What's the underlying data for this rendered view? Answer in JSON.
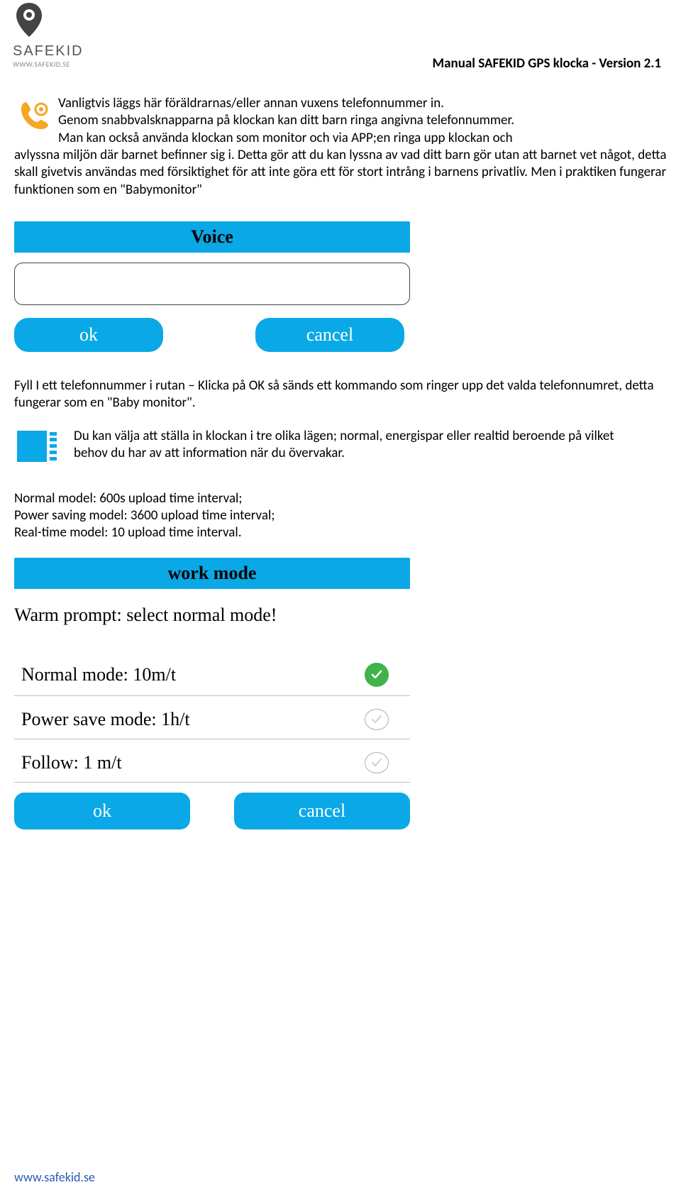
{
  "header": {
    "logo_text": "SAFEKID",
    "logo_url": "WWW.SAFEKID.SE",
    "title": "Manual SAFEKID GPS klocka - Version 2.1"
  },
  "section1": {
    "line1": "Vanligtvis läggs här föräldrarnas/eller annan vuxens telefonnummer in.",
    "line2": "Genom snabbvalsknapparna på klockan kan ditt barn ringa angivna telefonnummer.",
    "line3": "Man kan också använda klockan som monitor och via APP;en ringa upp klockan och",
    "cont": "avlyssna miljön där barnet befinner sig i. Detta gör att du kan lyssna av vad ditt barn gör utan att barnet vet något, detta skall givetvis användas med försiktighet för att inte göra ett för stort intrång i barnens privatliv. Men i praktiken fungerar funktionen som en \"Babymonitor\""
  },
  "voice_panel": {
    "title": "Voice",
    "ok": "ok",
    "cancel": "cancel"
  },
  "section2": {
    "text": "Fyll I ett telefonnummer i rutan – Klicka på OK så sänds ett kommando som ringer upp det valda telefonnumret, detta fungerar som en \"Baby monitor\"."
  },
  "section3": {
    "text": "Du kan välja att ställa in klockan i tre olika lägen; normal, energispar eller realtid beroende på vilket behov du har av att information när du övervakar."
  },
  "modes": {
    "line1": "Normal model: 600s upload time interval;",
    "line2": "Power saving model: 3600 upload time interval;",
    "line3": "Real-time model: 10 upload time interval."
  },
  "workmode": {
    "title": "work mode",
    "prompt": "Warm prompt: select normal mode!",
    "options": [
      {
        "label": "Normal mode: 10m/t",
        "selected": true
      },
      {
        "label": "Power save mode: 1h/t",
        "selected": false
      },
      {
        "label": "Follow: 1 m/t",
        "selected": false
      }
    ],
    "ok": "ok",
    "cancel": "cancel"
  },
  "footer": {
    "url": "www.safekid.se"
  }
}
